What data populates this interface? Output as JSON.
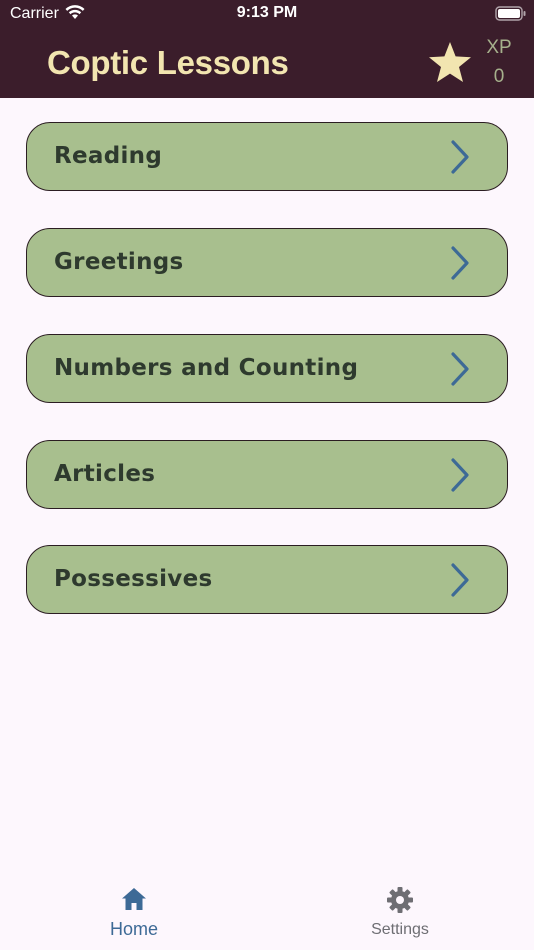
{
  "status_bar": {
    "carrier": "Carrier",
    "time": "9:13 PM",
    "wifi_icon": "wifi-icon",
    "battery_icon": "battery-icon"
  },
  "header": {
    "title": "Coptic Lessons",
    "xp_label": "XP",
    "xp_value": "0",
    "star_icon": "star-icon",
    "background_color": "#3b1d2b",
    "title_color": "#f2e5b0"
  },
  "lessons": [
    {
      "label": "Reading"
    },
    {
      "label": "Greetings"
    },
    {
      "label": "Numbers and Counting"
    },
    {
      "label": "Articles"
    },
    {
      "label": "Possessives"
    }
  ],
  "lesson_style": {
    "card_color": "#a8bf8e",
    "chevron_color": "#3d6a96",
    "chevron_icon": "chevron-right-icon"
  },
  "tab_bar": {
    "tabs": [
      {
        "label": "Home",
        "icon": "home-icon",
        "active": true
      },
      {
        "label": "Settings",
        "icon": "gear-icon",
        "active": false
      }
    ],
    "active_color": "#3d6a96",
    "inactive_color": "#6e6e73"
  }
}
